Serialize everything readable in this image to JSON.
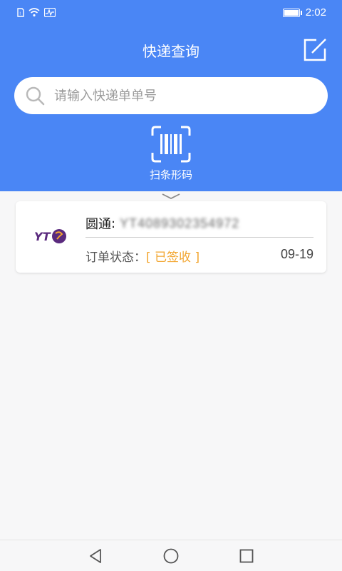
{
  "status_bar": {
    "time": "2:02"
  },
  "header": {
    "title": "快递查询"
  },
  "search": {
    "placeholder": "请输入快递单单号"
  },
  "scan": {
    "label": "扫条形码"
  },
  "results": [
    {
      "carrier": "圆通",
      "separator": ":",
      "tracking": "YT4089302354972",
      "status_label": "订单状态：",
      "status_value": "[ 已签收 ]",
      "date": "09-19",
      "logo_text": "YT"
    }
  ],
  "colors": {
    "brand": "#4a86f5",
    "status_accent": "#f2a52e"
  },
  "icons": {
    "edit": "edit-icon",
    "search": "search-icon",
    "scan": "barcode-scan-icon",
    "back": "nav-back-icon",
    "home": "nav-home-icon",
    "recent": "nav-recent-icon"
  }
}
